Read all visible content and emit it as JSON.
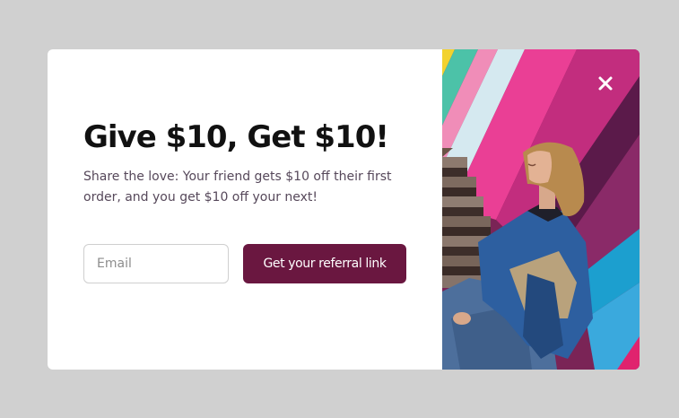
{
  "modal": {
    "headline": "Give $10, Get $10!",
    "subtext": "Share the love: Your friend gets $10 off their first order, and you get $10 off your next!",
    "email": {
      "value": "",
      "placeholder": "Email"
    },
    "cta_label": "Get your referral link",
    "image_icon": "woman-on-stairs-photo",
    "close_icon": "close-icon"
  },
  "colors": {
    "backdrop": "#d0d0d0",
    "modal_background": "#ffffff",
    "headline": "#111111",
    "subtext": "#56485a",
    "button": "#6a1740",
    "button_text": "#ffffff",
    "input_border": "#cfcfcf"
  }
}
